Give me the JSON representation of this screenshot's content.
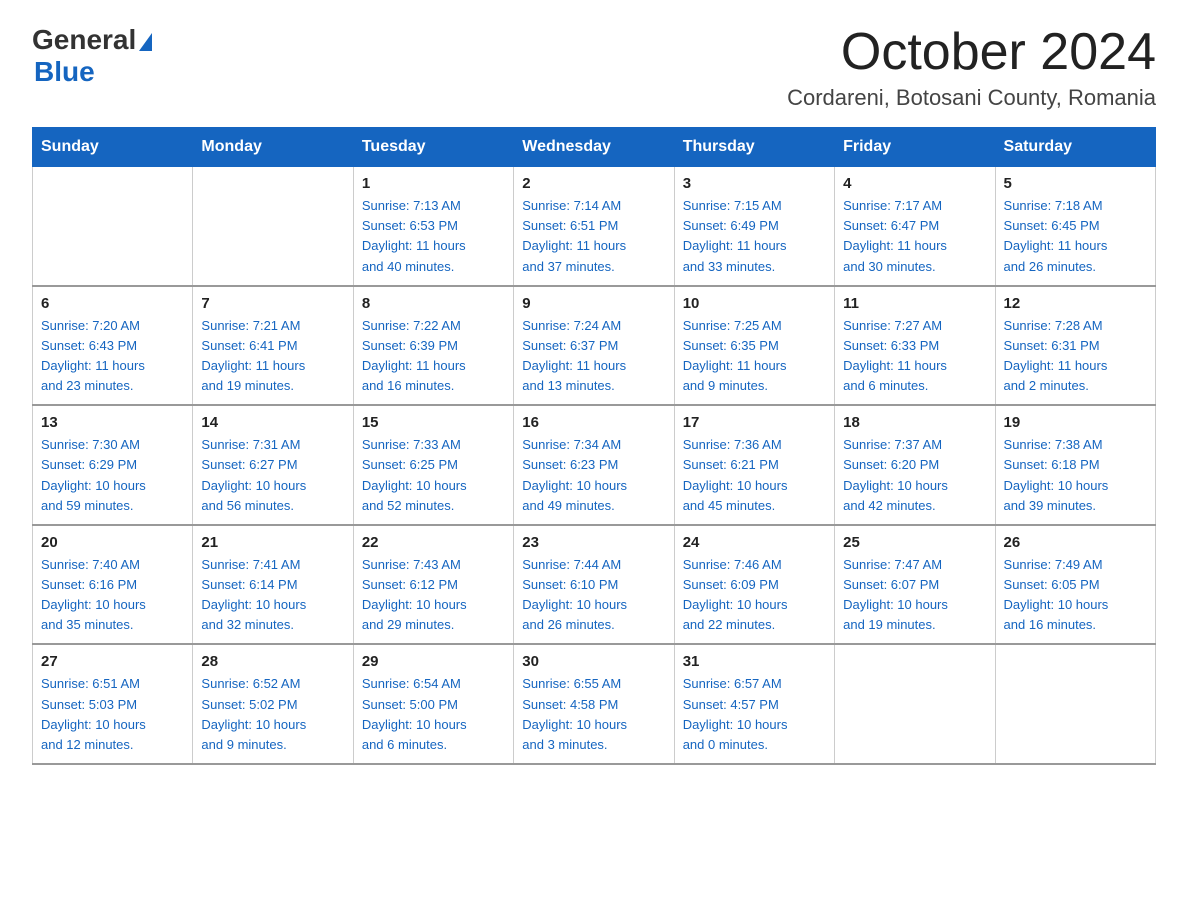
{
  "logo": {
    "text_general": "General",
    "text_blue": "Blue",
    "triangle": "▲"
  },
  "title": "October 2024",
  "subtitle": "Cordareni, Botosani County, Romania",
  "days_of_week": [
    "Sunday",
    "Monday",
    "Tuesday",
    "Wednesday",
    "Thursday",
    "Friday",
    "Saturday"
  ],
  "weeks": [
    [
      {
        "day": "",
        "info": ""
      },
      {
        "day": "",
        "info": ""
      },
      {
        "day": "1",
        "info": "Sunrise: 7:13 AM\nSunset: 6:53 PM\nDaylight: 11 hours\nand 40 minutes."
      },
      {
        "day": "2",
        "info": "Sunrise: 7:14 AM\nSunset: 6:51 PM\nDaylight: 11 hours\nand 37 minutes."
      },
      {
        "day": "3",
        "info": "Sunrise: 7:15 AM\nSunset: 6:49 PM\nDaylight: 11 hours\nand 33 minutes."
      },
      {
        "day": "4",
        "info": "Sunrise: 7:17 AM\nSunset: 6:47 PM\nDaylight: 11 hours\nand 30 minutes."
      },
      {
        "day": "5",
        "info": "Sunrise: 7:18 AM\nSunset: 6:45 PM\nDaylight: 11 hours\nand 26 minutes."
      }
    ],
    [
      {
        "day": "6",
        "info": "Sunrise: 7:20 AM\nSunset: 6:43 PM\nDaylight: 11 hours\nand 23 minutes."
      },
      {
        "day": "7",
        "info": "Sunrise: 7:21 AM\nSunset: 6:41 PM\nDaylight: 11 hours\nand 19 minutes."
      },
      {
        "day": "8",
        "info": "Sunrise: 7:22 AM\nSunset: 6:39 PM\nDaylight: 11 hours\nand 16 minutes."
      },
      {
        "day": "9",
        "info": "Sunrise: 7:24 AM\nSunset: 6:37 PM\nDaylight: 11 hours\nand 13 minutes."
      },
      {
        "day": "10",
        "info": "Sunrise: 7:25 AM\nSunset: 6:35 PM\nDaylight: 11 hours\nand 9 minutes."
      },
      {
        "day": "11",
        "info": "Sunrise: 7:27 AM\nSunset: 6:33 PM\nDaylight: 11 hours\nand 6 minutes."
      },
      {
        "day": "12",
        "info": "Sunrise: 7:28 AM\nSunset: 6:31 PM\nDaylight: 11 hours\nand 2 minutes."
      }
    ],
    [
      {
        "day": "13",
        "info": "Sunrise: 7:30 AM\nSunset: 6:29 PM\nDaylight: 10 hours\nand 59 minutes."
      },
      {
        "day": "14",
        "info": "Sunrise: 7:31 AM\nSunset: 6:27 PM\nDaylight: 10 hours\nand 56 minutes."
      },
      {
        "day": "15",
        "info": "Sunrise: 7:33 AM\nSunset: 6:25 PM\nDaylight: 10 hours\nand 52 minutes."
      },
      {
        "day": "16",
        "info": "Sunrise: 7:34 AM\nSunset: 6:23 PM\nDaylight: 10 hours\nand 49 minutes."
      },
      {
        "day": "17",
        "info": "Sunrise: 7:36 AM\nSunset: 6:21 PM\nDaylight: 10 hours\nand 45 minutes."
      },
      {
        "day": "18",
        "info": "Sunrise: 7:37 AM\nSunset: 6:20 PM\nDaylight: 10 hours\nand 42 minutes."
      },
      {
        "day": "19",
        "info": "Sunrise: 7:38 AM\nSunset: 6:18 PM\nDaylight: 10 hours\nand 39 minutes."
      }
    ],
    [
      {
        "day": "20",
        "info": "Sunrise: 7:40 AM\nSunset: 6:16 PM\nDaylight: 10 hours\nand 35 minutes."
      },
      {
        "day": "21",
        "info": "Sunrise: 7:41 AM\nSunset: 6:14 PM\nDaylight: 10 hours\nand 32 minutes."
      },
      {
        "day": "22",
        "info": "Sunrise: 7:43 AM\nSunset: 6:12 PM\nDaylight: 10 hours\nand 29 minutes."
      },
      {
        "day": "23",
        "info": "Sunrise: 7:44 AM\nSunset: 6:10 PM\nDaylight: 10 hours\nand 26 minutes."
      },
      {
        "day": "24",
        "info": "Sunrise: 7:46 AM\nSunset: 6:09 PM\nDaylight: 10 hours\nand 22 minutes."
      },
      {
        "day": "25",
        "info": "Sunrise: 7:47 AM\nSunset: 6:07 PM\nDaylight: 10 hours\nand 19 minutes."
      },
      {
        "day": "26",
        "info": "Sunrise: 7:49 AM\nSunset: 6:05 PM\nDaylight: 10 hours\nand 16 minutes."
      }
    ],
    [
      {
        "day": "27",
        "info": "Sunrise: 6:51 AM\nSunset: 5:03 PM\nDaylight: 10 hours\nand 12 minutes."
      },
      {
        "day": "28",
        "info": "Sunrise: 6:52 AM\nSunset: 5:02 PM\nDaylight: 10 hours\nand 9 minutes."
      },
      {
        "day": "29",
        "info": "Sunrise: 6:54 AM\nSunset: 5:00 PM\nDaylight: 10 hours\nand 6 minutes."
      },
      {
        "day": "30",
        "info": "Sunrise: 6:55 AM\nSunset: 4:58 PM\nDaylight: 10 hours\nand 3 minutes."
      },
      {
        "day": "31",
        "info": "Sunrise: 6:57 AM\nSunset: 4:57 PM\nDaylight: 10 hours\nand 0 minutes."
      },
      {
        "day": "",
        "info": ""
      },
      {
        "day": "",
        "info": ""
      }
    ]
  ]
}
